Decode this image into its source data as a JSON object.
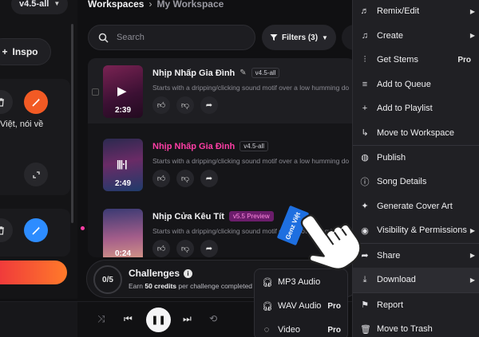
{
  "left_panel": {
    "model_label": "v4.5-all",
    "inspo_label": "Inspo",
    "card_text": "Việt, nói về"
  },
  "breadcrumb": {
    "root": "Workspaces",
    "current": "My Workspace"
  },
  "search": {
    "placeholder": "Search"
  },
  "filters": {
    "label": "Filters (3)"
  },
  "songs": [
    {
      "title": "Nhịp Nhấp Gia Đình",
      "tag": "v4.5-all",
      "description": "Starts with a dripping/clicking sound motif over a low humming do",
      "duration": "2:39"
    },
    {
      "title": "Nhịp Nhấp Gia Đình",
      "tag": "v4.5-all",
      "description": "Starts with a dripping/clicking sound motif over a low humming do",
      "duration": "2:49"
    },
    {
      "title": "Nhịp Cửa Kêu Tít",
      "tag": "v5.5 Preview",
      "description": "Starts with a dripping/clicking sound motif over a low humming do",
      "duration": "0:24"
    }
  ],
  "challenges": {
    "progress": "0/5",
    "title": "Challenges",
    "subtitle_prefix": "Earn",
    "subtitle_bold": "50 credits",
    "subtitle_suffix": "per challenge completed"
  },
  "context_menu": {
    "items": [
      {
        "label": "Remix/Edit",
        "icon": "remix-icon",
        "has_arrow": true
      },
      {
        "label": "Create",
        "icon": "music-note-icon",
        "has_arrow": true
      },
      {
        "label": "Get Stems",
        "icon": "stems-icon",
        "badge": "Pro"
      },
      {
        "label": "Add to Queue",
        "icon": "queue-icon"
      },
      {
        "label": "Add to Playlist",
        "icon": "plus-icon"
      },
      {
        "label": "Move to Workspace",
        "icon": "move-icon"
      },
      {
        "label": "Publish",
        "icon": "globe-icon"
      },
      {
        "label": "Song Details",
        "icon": "info-icon"
      },
      {
        "label": "Generate Cover Art",
        "icon": "sparkle-icon"
      },
      {
        "label": "Visibility & Permissions",
        "icon": "eye-icon",
        "has_arrow": true
      },
      {
        "label": "Share",
        "icon": "share-icon",
        "has_arrow": true
      },
      {
        "label": "Download",
        "icon": "download-icon",
        "has_arrow": true
      },
      {
        "label": "Report",
        "icon": "flag-icon"
      },
      {
        "label": "Move to Trash",
        "icon": "trash-icon"
      }
    ]
  },
  "download_submenu": {
    "items": [
      {
        "label": "MP3 Audio",
        "icon": "headphones-icon"
      },
      {
        "label": "WAV Audio",
        "icon": "headphones-icon",
        "badge": "Pro"
      },
      {
        "label": "Video",
        "icon": "video-icon",
        "badge": "Pro"
      }
    ]
  },
  "watermark_text": "Genz Việt"
}
